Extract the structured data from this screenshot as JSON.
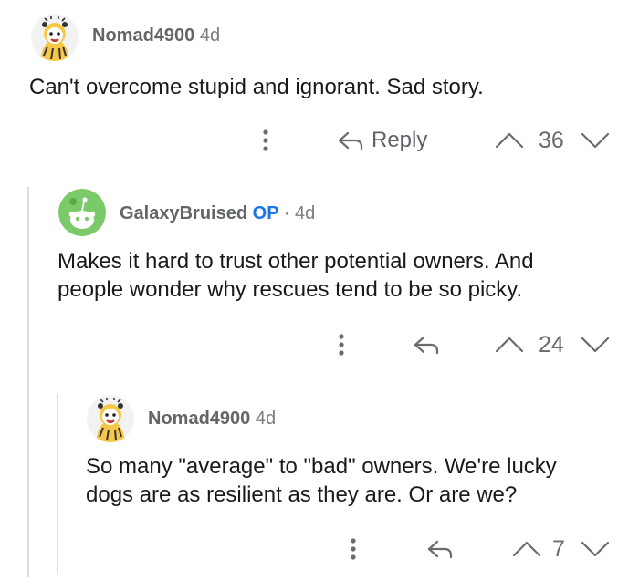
{
  "comments": [
    {
      "username": "Nomad4900",
      "time": "4d",
      "op_badge": "",
      "text_lines": [
        "Can't overcome stupid and ignorant.  Sad story."
      ],
      "reply_label": "Reply",
      "votes": "36"
    },
    {
      "username": "GalaxyBruised",
      "time": "· 4d",
      "op_badge": "OP",
      "text_lines": [
        "Makes it hard to trust other potential owners. And",
        "people wonder why rescues tend to be so picky."
      ],
      "reply_label": "",
      "votes": "24"
    },
    {
      "username": "Nomad4900",
      "time": "4d",
      "op_badge": "",
      "text_lines": [
        "So many \"average\" to \"bad\" owners.  We're lucky",
        "dogs are as resilient as they are.  Or are we?"
      ],
      "reply_label": "",
      "votes": "7"
    }
  ],
  "colors": {
    "text": "#1a1a1b",
    "meta": "#636669",
    "op": "#1a73e8",
    "icon": "#6b6b6b",
    "thread_line": "#dcdcdc",
    "avatar_green": "#7cc96a",
    "avatar_yellow": "#f5c84a"
  },
  "icons": [
    "more-vertical-icon",
    "reply-arrow-icon",
    "upvote-icon",
    "downvote-icon",
    "avatar-icon"
  ]
}
